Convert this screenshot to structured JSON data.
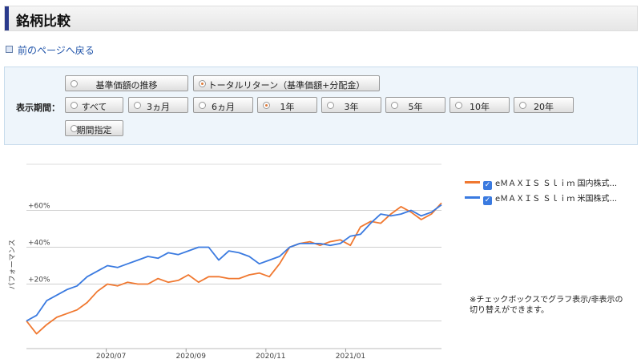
{
  "page": {
    "title": "銘柄比較",
    "back_link": "前のページへ戻る"
  },
  "filters": {
    "period_label": "表示期間：",
    "basis_options": [
      {
        "label": "基準価額の推移",
        "selected": false
      },
      {
        "label": "トータルリターン（基準価額+分配金）",
        "selected": true
      }
    ],
    "period_options": [
      {
        "label": "すべて",
        "selected": false
      },
      {
        "label": "3ヵ月",
        "selected": false
      },
      {
        "label": "6ヵ月",
        "selected": false
      },
      {
        "label": "1年",
        "selected": true
      },
      {
        "label": "3年",
        "selected": false
      },
      {
        "label": "5年",
        "selected": false
      },
      {
        "label": "10年",
        "selected": false
      },
      {
        "label": "20年",
        "selected": false
      },
      {
        "label": "期間指定",
        "selected": false
      }
    ]
  },
  "legend": [
    {
      "label": "eＭＡＸＩＳ Ｓｌｉｍ 国内株式...",
      "color": "#f07830",
      "checked": true
    },
    {
      "label": "eＭＡＸＩＳ Ｓｌｉｍ 米国株式...",
      "color": "#3a7ae0",
      "checked": true
    }
  ],
  "note": "※チェックボックスでグラフ表示/非表示の切り替えができます。",
  "chart_data": {
    "type": "line",
    "ylabel": "パフォーマンス",
    "y_ticks": [
      "+60%",
      "+40%",
      "+20%"
    ],
    "y_tick_values": [
      60,
      40,
      20
    ],
    "x_ticks": [
      "2020/07",
      "2020/09",
      "2020/11",
      "2021/01"
    ],
    "ylim": [
      -15,
      85
    ],
    "grid": true,
    "series": [
      {
        "name": "eＭＡＸＩＳ Ｓｌｉｍ 国内株式...",
        "color": "#f07830",
        "values": [
          0,
          -7,
          -2,
          2,
          4,
          6,
          10,
          16,
          20,
          19,
          21,
          20,
          20,
          23,
          21,
          22,
          25,
          21,
          24,
          24,
          23,
          23,
          25,
          26,
          24,
          31,
          40,
          42,
          43,
          41,
          43,
          44,
          41,
          51,
          54,
          53,
          58,
          62,
          59,
          55,
          58,
          64
        ]
      },
      {
        "name": "eＭＡＸＩＳ Ｓｌｉｍ 米国株式...",
        "color": "#3a7ae0",
        "values": [
          0,
          3,
          11,
          14,
          17,
          19,
          24,
          27,
          30,
          29,
          31,
          33,
          35,
          34,
          37,
          36,
          38,
          40,
          40,
          33,
          38,
          37,
          35,
          31,
          33,
          35,
          40,
          42,
          42,
          42,
          41,
          42,
          46,
          47,
          53,
          58,
          57,
          58,
          60,
          57,
          59,
          63
        ]
      }
    ]
  }
}
